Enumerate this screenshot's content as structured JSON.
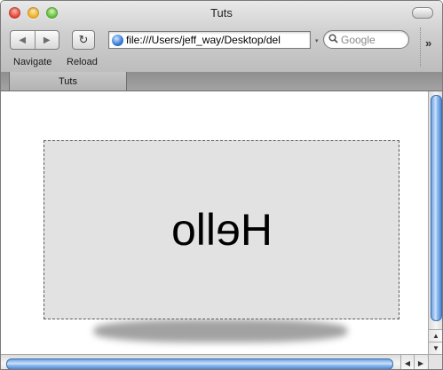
{
  "window": {
    "title": "Tuts"
  },
  "toolbar": {
    "back_icon": "◀",
    "forward_icon": "▶",
    "reload_icon": "↻",
    "navigate_label": "Navigate",
    "reload_label": "Reload",
    "url": "file:///Users/jeff_way/Desktop/del",
    "url_dropdown_icon": "▾",
    "search_icon": "🔍",
    "search_placeholder": "Google",
    "overflow_icon": "»"
  },
  "tabs": [
    {
      "label": "Tuts"
    }
  ],
  "content": {
    "box_text": "Hello",
    "box_mirrored": true
  },
  "scrollbars": {
    "up_arrow": "▲",
    "down_arrow": "▼",
    "left_arrow": "◀",
    "right_arrow": "▶"
  },
  "colors": {
    "box_background": "#e2e2e2",
    "scroll_thumb": "#6fa3e3"
  }
}
